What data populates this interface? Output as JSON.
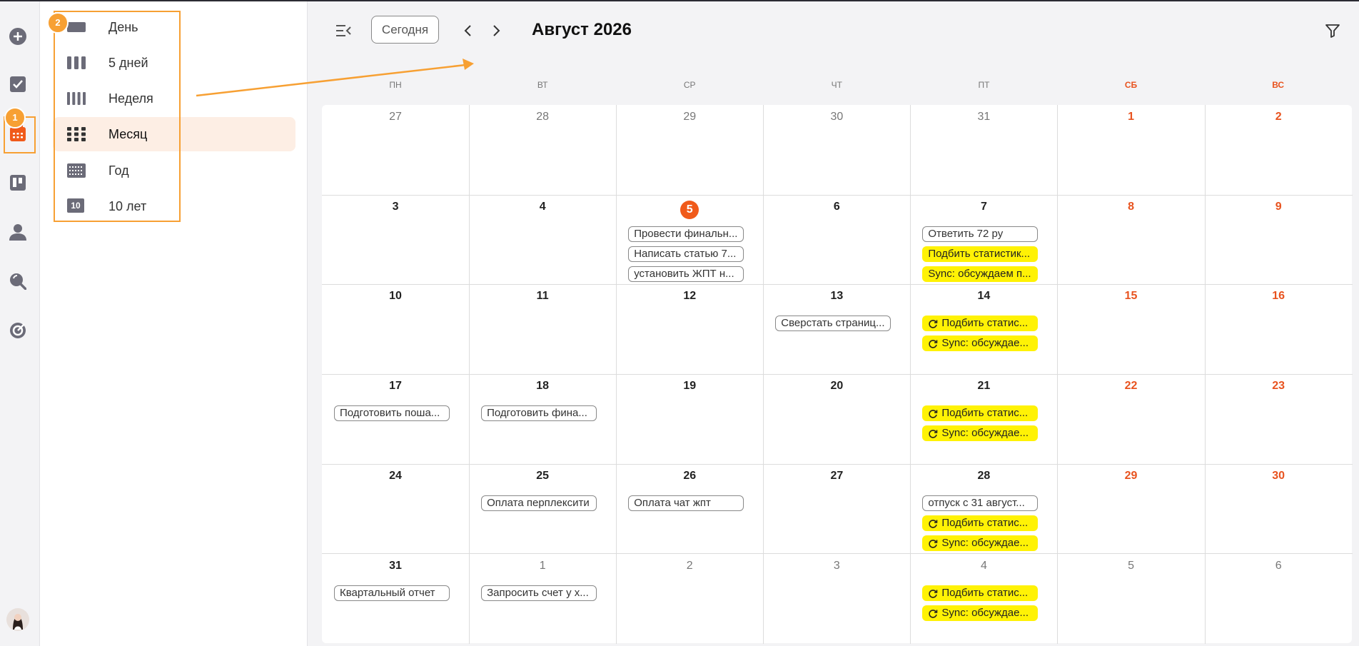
{
  "views": [
    {
      "label": "День",
      "icon": "day-view-icon",
      "active": false
    },
    {
      "label": "5 дней",
      "icon": "five-days-view-icon",
      "active": false
    },
    {
      "label": "Неделя",
      "icon": "week-view-icon",
      "active": false
    },
    {
      "label": "Месяц",
      "icon": "month-view-icon",
      "active": true
    },
    {
      "label": "Год",
      "icon": "year-view-icon",
      "active": false
    },
    {
      "label": "10 лет",
      "icon": "decade-view-icon",
      "badge": "10",
      "active": false
    }
  ],
  "annotations": {
    "badge1": "1",
    "badge2": "2"
  },
  "header": {
    "today": "Сегодня",
    "month": "Август 2026"
  },
  "weekdays": [
    "ПН",
    "ВТ",
    "СР",
    "ЧТ",
    "ПТ",
    "СБ",
    "ВС"
  ],
  "colors": {
    "accent": "#f05a1a",
    "weekend": "#e8531f",
    "highlight": "#fff205",
    "annotation": "#f7a033"
  },
  "weeks": [
    [
      {
        "n": "27",
        "other": true,
        "events": []
      },
      {
        "n": "28",
        "other": true,
        "events": []
      },
      {
        "n": "29",
        "other": true,
        "events": []
      },
      {
        "n": "30",
        "other": true,
        "events": []
      },
      {
        "n": "31",
        "other": true,
        "events": []
      },
      {
        "n": "1",
        "events": []
      },
      {
        "n": "2",
        "events": []
      }
    ],
    [
      {
        "n": "3",
        "events": []
      },
      {
        "n": "4",
        "events": []
      },
      {
        "n": "5",
        "today": true,
        "events": [
          {
            "t": "Провести финальн..."
          },
          {
            "t": "Написать статью 7..."
          },
          {
            "t": "установить ЖПТ н..."
          }
        ]
      },
      {
        "n": "6",
        "events": []
      },
      {
        "n": "7",
        "events": [
          {
            "t": "Ответить 72 ру"
          },
          {
            "t": "Подбить статистик...",
            "yellow": true
          },
          {
            "t": "Sync: обсуждаем п...",
            "yellow": true
          }
        ]
      },
      {
        "n": "8",
        "events": []
      },
      {
        "n": "9",
        "events": []
      }
    ],
    [
      {
        "n": "10",
        "events": []
      },
      {
        "n": "11",
        "events": []
      },
      {
        "n": "12",
        "events": []
      },
      {
        "n": "13",
        "events": [
          {
            "t": "Сверстать страниц..."
          }
        ]
      },
      {
        "n": "14",
        "events": [
          {
            "t": "Подбить статис...",
            "yellow": true,
            "recur": true
          },
          {
            "t": "Sync: обсуждае...",
            "yellow": true,
            "recur": true
          }
        ]
      },
      {
        "n": "15",
        "events": []
      },
      {
        "n": "16",
        "events": []
      }
    ],
    [
      {
        "n": "17",
        "events": [
          {
            "t": "Подготовить поша..."
          }
        ]
      },
      {
        "n": "18",
        "events": [
          {
            "t": "Подготовить фина..."
          }
        ]
      },
      {
        "n": "19",
        "events": []
      },
      {
        "n": "20",
        "events": []
      },
      {
        "n": "21",
        "events": [
          {
            "t": "Подбить статис...",
            "yellow": true,
            "recur": true
          },
          {
            "t": "Sync: обсуждае...",
            "yellow": true,
            "recur": true
          }
        ]
      },
      {
        "n": "22",
        "events": []
      },
      {
        "n": "23",
        "events": []
      }
    ],
    [
      {
        "n": "24",
        "events": []
      },
      {
        "n": "25",
        "events": [
          {
            "t": "Оплата перплексити"
          }
        ]
      },
      {
        "n": "26",
        "events": [
          {
            "t": "Оплата чат жпт"
          }
        ]
      },
      {
        "n": "27",
        "events": []
      },
      {
        "n": "28",
        "events": [
          {
            "t": "отпуск с 31 август..."
          },
          {
            "t": "Подбить статис...",
            "yellow": true,
            "recur": true
          },
          {
            "t": "Sync: обсуждае...",
            "yellow": true,
            "recur": true
          }
        ]
      },
      {
        "n": "29",
        "events": []
      },
      {
        "n": "30",
        "events": []
      }
    ],
    [
      {
        "n": "31",
        "events": [
          {
            "t": "Квартальный отчет"
          }
        ]
      },
      {
        "n": "1",
        "other": true,
        "events": [
          {
            "t": "Запросить счет у х..."
          }
        ]
      },
      {
        "n": "2",
        "other": true,
        "events": []
      },
      {
        "n": "3",
        "other": true,
        "events": []
      },
      {
        "n": "4",
        "other": true,
        "events": [
          {
            "t": "Подбить статис...",
            "yellow": true,
            "recur": true
          },
          {
            "t": "Sync: обсуждае...",
            "yellow": true,
            "recur": true
          }
        ]
      },
      {
        "n": "5",
        "other": true,
        "events": []
      },
      {
        "n": "6",
        "other": true,
        "events": []
      }
    ]
  ]
}
